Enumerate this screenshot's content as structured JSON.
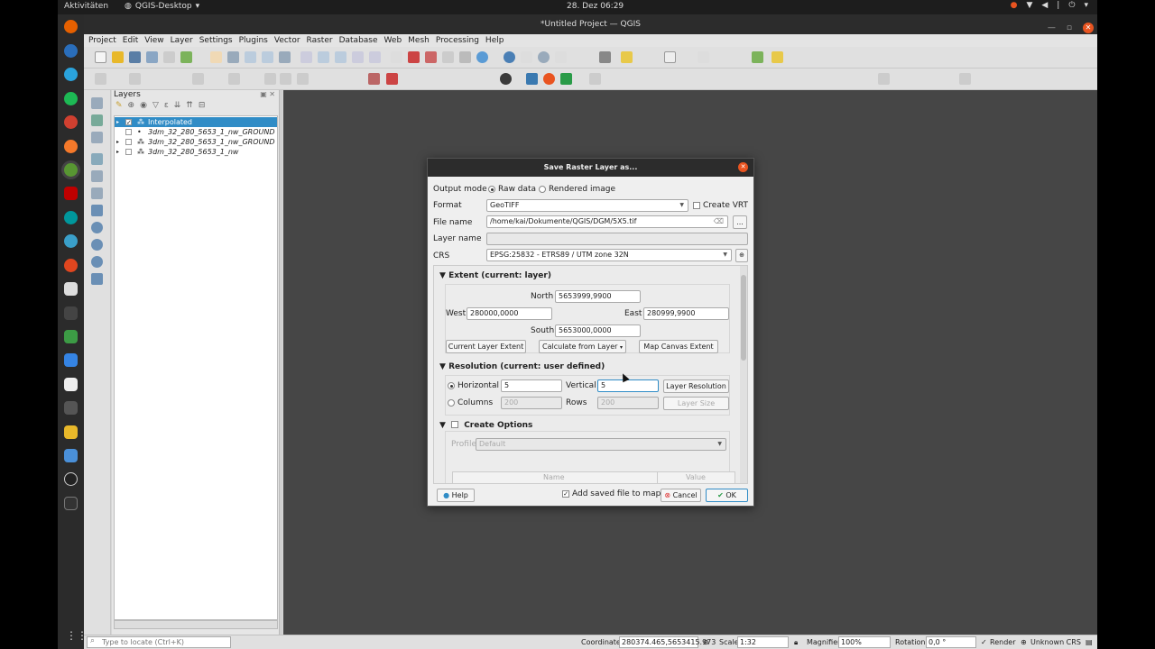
{
  "topbar": {
    "activities": "Aktivitäten",
    "app_name": "QGIS-Desktop",
    "clock": "28. Dez  06:29"
  },
  "window": {
    "title": "*Untitled Project — QGIS"
  },
  "menu": [
    "Project",
    "Edit",
    "View",
    "Layer",
    "Settings",
    "Plugins",
    "Vector",
    "Raster",
    "Database",
    "Web",
    "Mesh",
    "Processing",
    "Help"
  ],
  "layers_panel": {
    "title": "Layers",
    "items": [
      {
        "name": "Interpolated",
        "checked": true,
        "selected": true
      },
      {
        "name": "3dm_32_280_5653_1_nw_GROUND",
        "checked": false,
        "selected": false
      },
      {
        "name": "3dm_32_280_5653_1_nw_GROUND",
        "checked": false,
        "selected": false
      },
      {
        "name": "3dm_32_280_5653_1_nw",
        "checked": false,
        "selected": false
      }
    ]
  },
  "statusbar": {
    "locate_placeholder": "Type to locate (Ctrl+K)",
    "coordinate_label": "Coordinate",
    "coordinate_value": "280374.465,5653415.973",
    "scale_label": "Scale",
    "scale_value": "1:32",
    "magnifier_label": "Magnifier",
    "magnifier_value": "100%",
    "rotation_label": "Rotation",
    "rotation_value": "0,0 °",
    "render_label": "Render",
    "crs_label": "Unknown CRS"
  },
  "dialog": {
    "title": "Save Raster Layer as...",
    "output_mode_label": "Output mode",
    "raw_data_label": "Raw data",
    "rendered_image_label": "Rendered image",
    "format_label": "Format",
    "format_value": "GeoTIFF",
    "create_vrt_label": "Create VRT",
    "filename_label": "File name",
    "filename_value": "/home/kai/Dokumente/QGIS/DGM/5X5.tif",
    "browse_label": "...",
    "layername_label": "Layer name",
    "crs_label": "CRS",
    "crs_value": "EPSG:25832 - ETRS89 / UTM zone 32N",
    "extent": {
      "title": "Extent (current: layer)",
      "north_label": "North",
      "north_value": "5653999,9900",
      "west_label": "West",
      "west_value": "280000,0000",
      "east_label": "East",
      "east_value": "280999,9900",
      "south_label": "South",
      "south_value": "5653000,0000",
      "current_layer_btn": "Current Layer Extent",
      "calc_from_layer_btn": "Calculate from Layer",
      "map_canvas_btn": "Map Canvas Extent"
    },
    "resolution": {
      "title": "Resolution (current: user defined)",
      "horizontal_label": "Horizontal",
      "horizontal_value": "5",
      "vertical_label": "Vertical",
      "vertical_value": "5",
      "layer_resolution_btn": "Layer Resolution",
      "columns_label": "Columns",
      "columns_value": "200",
      "rows_label": "Rows",
      "rows_value": "200",
      "layer_size_btn": "Layer Size"
    },
    "create_options": {
      "title": "Create Options",
      "profile_label": "Profile",
      "profile_value": "Default",
      "col_name": "Name",
      "col_value": "Value"
    },
    "help_btn": "Help",
    "add_to_map_label": "Add saved file to map",
    "cancel_btn": "Cancel",
    "ok_btn": "OK"
  },
  "colors": {
    "accent": "#308cc6",
    "close": "#e95420",
    "canvas": "#464646"
  }
}
